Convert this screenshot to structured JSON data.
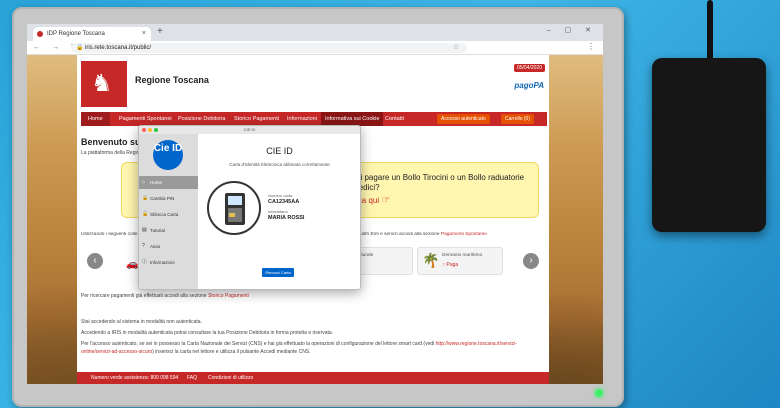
{
  "browser": {
    "tab_title": "IDP Regione Toscana",
    "tab_close": "×",
    "new_tab": "+",
    "window_controls": "– ▢ ✕",
    "nav": "← → ↻",
    "url": "iris.rete.toscana.it/public/",
    "lock": "🔒",
    "star": "☆",
    "menu": "⋮"
  },
  "site": {
    "title": "Regione Toscana",
    "date": "05/04/2020",
    "pagopa": "pagoPA",
    "logo_glyph": "♞"
  },
  "navbar": {
    "items": [
      "Home",
      "Pagamenti Spontanei",
      "Posizione Debitoria",
      "Storico Pagamenti",
      "Informazioni",
      "Informativa sui Cookie",
      "Contatti"
    ],
    "accesso": "Accesso autenticato",
    "carrello": "Carrello (0)"
  },
  "welcome": {
    "title": "Benvenuto su IR",
    "subtitle": "La piattaforma della Region"
  },
  "promo": {
    "text": "evi pagare un Bollo Tirocini o un Bollo raduatorie Medici?",
    "link": "icca qui",
    "hand": "☞"
  },
  "using": {
    "prefix": "Utilizzando i seguenti colle",
    "middle": "uare un pagamento per altri Enti e servizi accedi alla sezione ",
    "link": "Pagamenti Spontanei"
  },
  "services": {
    "prev": "‹",
    "next": "›",
    "car": "🚗",
    "card1_name": "ase Gas Naturale",
    "card1_pay": "",
    "card2_icon": "🌴",
    "card2_name": "Demanio marittimo",
    "card2_pay": "☞Paga"
  },
  "search_line": {
    "text": "Per ricercare pagamenti già effettuati accedi alla sezione ",
    "link": "Storico Pagamenti"
  },
  "info": {
    "p1": "Stai accedendo al sistema in modalità non autenticata.",
    "p2": "Accedendo a IRIS in modalità autenticata potrai consultare la tua Posizione Debitoria in forma protetta e riservata.",
    "p3a": "Per l'accesso autenticato, se sei in possesso la Carta Nazionale dei Servizi (CNS) e hai già effettuato la operazioni di configurazione del lettore smart card (vedi ",
    "p3link": "http://www.regione.toscana.it/servizi-online/servizi-ad-accesso-sicuro",
    "p3b": ") inserisci la carta nel lettore e utilizza il pulsante Accedi mediante CNS."
  },
  "footer": {
    "phone": "Numero verde assistenza: 800 098 594",
    "faq": "FAQ",
    "conditions": "Condizioni di utilizzo"
  },
  "dialog": {
    "window_title": "CIE ID",
    "logo": "Cie ID",
    "sidebar": [
      {
        "icon": "⌂",
        "label": "Home"
      },
      {
        "icon": "🔒",
        "label": "Cambia PIN"
      },
      {
        "icon": "🔓",
        "label": "Sblocca Carta"
      },
      {
        "icon": "▤",
        "label": "Tutorial"
      },
      {
        "icon": "?",
        "label": "Aiuto"
      },
      {
        "icon": "ⓘ",
        "label": "Informazioni"
      }
    ],
    "title": "CIE ID",
    "subtitle": "Carta d'Identità Elettronica abbinata correttamente",
    "card_number_label": "Numero carta",
    "card_number": "CA12345AA",
    "holder_label": "Intestatario",
    "holder": "MARIA ROSSI",
    "remove_button": "Rimuovi Carta"
  },
  "colors": {
    "brand_red": "#c62828",
    "cie_blue": "#0066cc",
    "promo_yellow": "#fff6b0",
    "desk_blue": "#29a3d8"
  }
}
